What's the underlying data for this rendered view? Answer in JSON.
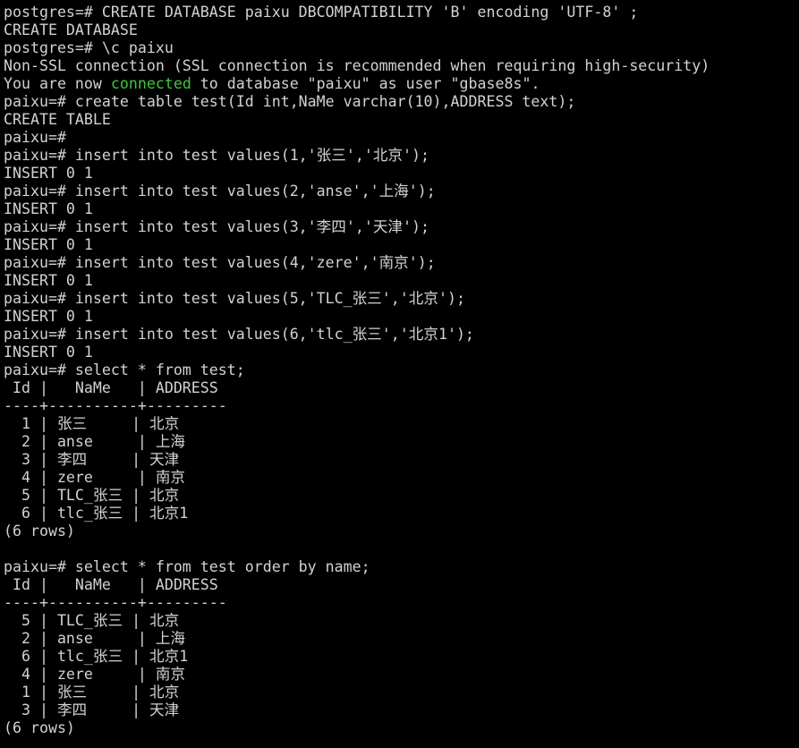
{
  "colors": {
    "background": "#000000",
    "text": "#d2d2d2",
    "highlight": "#3ec73e"
  },
  "lines": [
    "postgres=# CREATE DATABASE paixu DBCOMPATIBILITY 'B' encoding 'UTF-8' ;",
    "CREATE DATABASE",
    "postgres=# \\c paixu",
    "Non-SSL connection (SSL connection is recommended when requiring high-security)",
    {
      "before": "You are now ",
      "highlight": "connected",
      "after": " to database \"paixu\" as user \"gbase8s\"."
    },
    "paixu=# create table test(Id int,NaMe varchar(10),ADDRESS text);",
    "CREATE TABLE",
    "paixu=#",
    "paixu=# insert into test values(1,'张三','北京');",
    "INSERT 0 1",
    "paixu=# insert into test values(2,'anse','上海');",
    "INSERT 0 1",
    "paixu=# insert into test values(3,'李四','天津');",
    "INSERT 0 1",
    "paixu=# insert into test values(4,'zere','南京');",
    "INSERT 0 1",
    "paixu=# insert into test values(5,'TLC_张三','北京');",
    "INSERT 0 1",
    "paixu=# insert into test values(6,'tlc_张三','北京1');",
    "INSERT 0 1",
    "paixu=# select * from test;",
    " Id |   NaMe   | ADDRESS",
    "----+----------+---------",
    "  1 | 张三     | 北京",
    "  2 | anse     | 上海",
    "  3 | 李四     | 天津",
    "  4 | zere     | 南京",
    "  5 | TLC_张三 | 北京",
    "  6 | tlc_张三 | 北京1",
    "(6 rows)",
    "",
    "paixu=# select * from test order by name;",
    " Id |   NaMe   | ADDRESS",
    "----+----------+---------",
    "  5 | TLC_张三 | 北京",
    "  2 | anse     | 上海",
    "  6 | tlc_张三 | 北京1",
    "  4 | zere     | 南京",
    "  1 | 张三     | 北京",
    "  3 | 李四     | 天津",
    "(6 rows)"
  ]
}
